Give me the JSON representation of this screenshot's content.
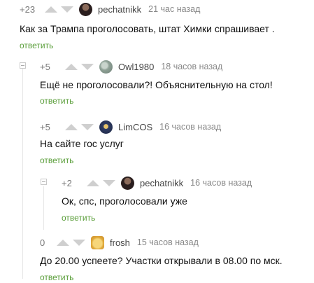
{
  "comments": [
    {
      "rating": "+23",
      "user": "pechatnikk",
      "time": "21 час назад",
      "text": "Как за Трампа проголосовать, штат Химки спрашивает .",
      "reply": "ответить",
      "avatar_color": "#3a2a2a"
    },
    {
      "rating": "+5",
      "user": "Owl1980",
      "time": "18 часов назад",
      "text": "Ещё не проголосовали?! Объяснительную на стол!",
      "reply": "ответить",
      "avatar_color": "#9aa8a0"
    },
    {
      "rating": "+5",
      "user": "LimCOS",
      "time": "16 часов назад",
      "text": "На сайте гос услуг",
      "reply": "ответить",
      "avatar_color": "#2f3c63"
    },
    {
      "rating": "+2",
      "user": "pechatnikk",
      "time": "16 часов назад",
      "text": "Ок, спс, проголосовали уже",
      "reply": "ответить",
      "avatar_color": "#3a2a2a"
    },
    {
      "rating": "0",
      "user": "frosh",
      "time": "15 часов назад",
      "text": "До 20.00 успеете? Участки открывали в 08.00 по мск.",
      "reply": "ответить",
      "avatar_color": "#f0c560"
    }
  ]
}
